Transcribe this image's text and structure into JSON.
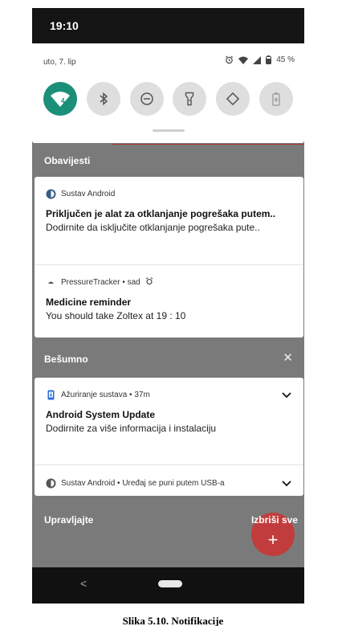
{
  "status_bar": {
    "time": "19:10"
  },
  "quick_settings": {
    "date": "uto, 7. lip",
    "battery": "45 %",
    "tiles": [
      "wifi",
      "bluetooth",
      "do-not-disturb",
      "flashlight",
      "auto-rotate",
      "battery-saver"
    ]
  },
  "sections": {
    "notifications_title": "Obavijesti",
    "silent_title": "Bešumno",
    "silent_close": "✕"
  },
  "notifications": [
    {
      "app": "Sustav Android",
      "title": "Priključen je alat za otklanjanje pogrešaka putem..",
      "text": "Dodirnite da isključite otklanjanje pogrešaka pute.."
    },
    {
      "app": "PressureTracker • sad",
      "title": "Medicine reminder",
      "text": "You should take Zoltex at 19 : 10"
    },
    {
      "app": "Ažuriranje sustava • 37m",
      "title": "Android System Update",
      "text": "Dodirnite za više informacija i instalaciju"
    },
    {
      "app": "Sustav Android • Uređaj se puni putem USB-a"
    }
  ],
  "footer": {
    "manage": "Upravljajte",
    "clear_all": "Izbriši sve",
    "fab": "+"
  },
  "nav": {
    "back": "<"
  },
  "caption": "Slika 5.10. Notifikacije"
}
